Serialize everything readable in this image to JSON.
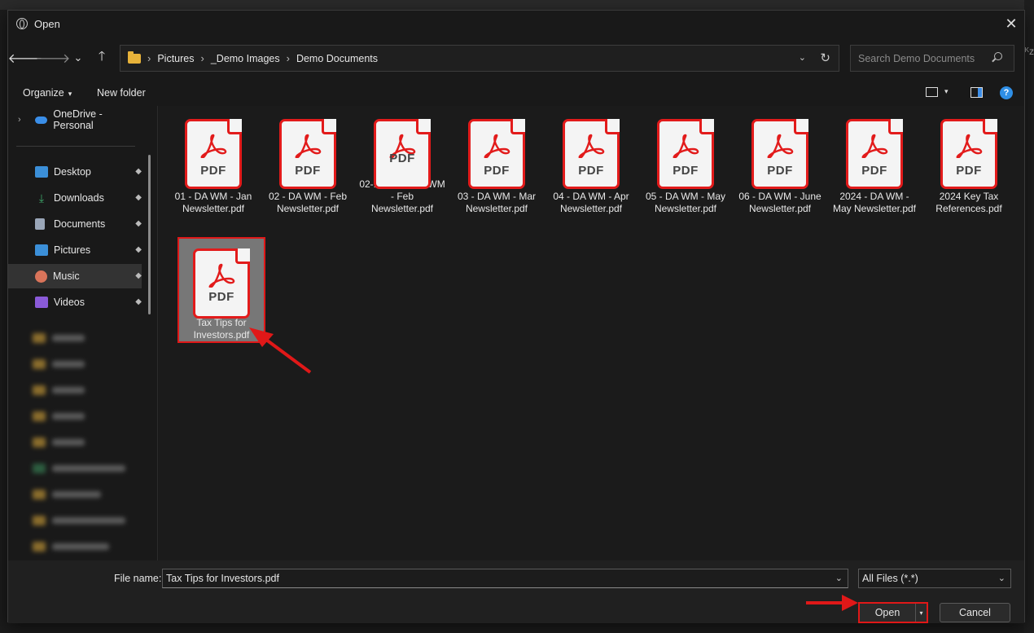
{
  "titlebar": {
    "title": "Open",
    "icon": "globe-icon",
    "close_symbol": "✕"
  },
  "bg_text": "ᴷz",
  "nav_buttons": {
    "back": "🡐",
    "forward": "🡒",
    "recent": "⌄",
    "up": "🡑"
  },
  "address": {
    "crumbs": [
      "Pictures",
      "_Demo Images",
      "Demo Documents"
    ],
    "separator": "›",
    "dropdown": "⌄",
    "refresh": "↻"
  },
  "search": {
    "placeholder": "Search Demo Documents"
  },
  "toolbar": {
    "organize_label": "Organize",
    "organize_caret": "▾",
    "new_folder_label": "New folder",
    "view_caret": "▾",
    "help": "?"
  },
  "sidebar": {
    "onedrive": {
      "label": "OneDrive - Personal",
      "expander": "›",
      "color": "#3a8ee8"
    },
    "quick": [
      {
        "label": "Desktop",
        "icon": "desktop-icon",
        "color": "#3b8fd8"
      },
      {
        "label": "Downloads",
        "icon": "downloads-icon",
        "color": "#3ea86a"
      },
      {
        "label": "Documents",
        "icon": "documents-icon",
        "color": "#9aa6b8"
      },
      {
        "label": "Pictures",
        "icon": "pictures-icon",
        "color": "#3b8fd8"
      },
      {
        "label": "Music",
        "icon": "music-icon",
        "color": "#d9745a"
      },
      {
        "label": "Videos",
        "icon": "videos-icon",
        "color": "#8a5ad8"
      }
    ],
    "pin_symbol": "📌"
  },
  "files": [
    {
      "name": "01 - DA WM - Jan Newsletter.pdf",
      "type_label": "PDF"
    },
    {
      "name": "02 - DA WM - Feb Newsletter.pdf",
      "type_label": "PDF"
    },
    {
      "name": "02-1 - 2024 DA WM - Feb Newsletter.pdf",
      "type_label": "PDF"
    },
    {
      "name": "03 - DA WM - Mar Newsletter.pdf",
      "type_label": "PDF"
    },
    {
      "name": "04 - DA WM - Apr Newsletter.pdf",
      "type_label": "PDF"
    },
    {
      "name": "05 - DA WM - May Newsletter.pdf",
      "type_label": "PDF"
    },
    {
      "name": "06 - DA WM - June Newsletter.pdf",
      "type_label": "PDF"
    },
    {
      "name": "2024 - DA WM - May Newsletter.pdf",
      "type_label": "PDF"
    },
    {
      "name": "2024 Key Tax References.pdf",
      "type_label": "PDF"
    },
    {
      "name": "Tax Tips for Investors.pdf",
      "type_label": "PDF",
      "selected": true
    }
  ],
  "bottom": {
    "file_name_label": "File name:",
    "file_name_value": "Tax Tips for Investors.pdf",
    "filter_value": "All Files (*.*)",
    "dropdown": "⌄",
    "open_label": "Open",
    "open_split": "▾",
    "cancel_label": "Cancel"
  },
  "colors": {
    "highlight_red": "#e01818",
    "pdf_red": "#e21b1b",
    "folder_yellow": "#e8b33a",
    "selection_gray": "#777777"
  }
}
